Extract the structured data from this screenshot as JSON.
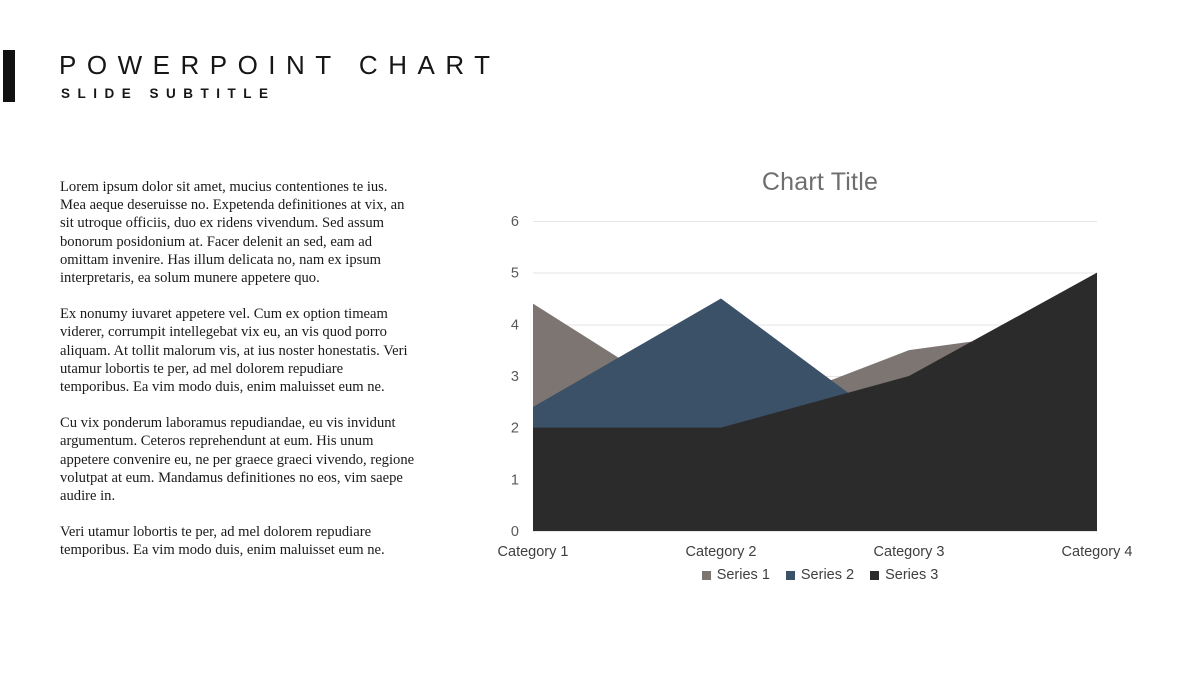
{
  "slide": {
    "title": "POWERPOINT CHART",
    "subtitle": "SLIDE SUBTITLE",
    "accent_color": "#111111"
  },
  "body": {
    "paragraphs": [
      "Lorem ipsum dolor sit amet, mucius contentiones te ius. Mea aeque deseruisse no. Expetenda definitiones at vix, an sit utroque officiis, duo ex ridens vivendum. Sed assum bonorum posidonium at. Facer delenit an sed, eam ad omittam invenire. Has illum delicata no, nam ex ipsum interpretaris, ea solum munere appetere quo.",
      "Ex nonumy iuvaret appetere vel. Cum ex option timeam viderer, corrumpit intellegebat vix eu, an vis quod porro aliquam. At tollit malorum vis, at ius noster honestatis. Veri utamur lobortis te per, ad mel dolorem repudiare temporibus. Ea vim modo duis, enim maluisset eum ne.",
      "Cu vix ponderum laboramus repudiandae, eu vis invidunt argumentum. Ceteros reprehendunt at eum. His unum appetere convenire eu, ne per graece graeci vivendo, regione volutpat at eum. Mandamus definitiones no eos, vim saepe audire in.",
      "Veri utamur lobortis te per, ad mel dolorem repudiare temporibus. Ea vim modo duis, enim maluisset eum ne."
    ]
  },
  "chart_data": {
    "type": "area",
    "title": "Chart Title",
    "xlabel": "",
    "ylabel": "",
    "categories": [
      "Category 1",
      "Category 2",
      "Category 3",
      "Category 4"
    ],
    "series": [
      {
        "name": "Series 1",
        "color": "#7d7571",
        "values": [
          4.4,
          2.1,
          3.5,
          4.0
        ]
      },
      {
        "name": "Series 2",
        "color": "#3a5168",
        "values": [
          2.4,
          4.5,
          1.8,
          0.0
        ]
      },
      {
        "name": "Series 3",
        "color": "#2b2b2b",
        "values": [
          2.0,
          2.0,
          3.0,
          5.0
        ]
      }
    ],
    "ylim": [
      0,
      6
    ],
    "yticks": [
      0,
      1,
      2,
      3,
      4,
      5,
      6
    ],
    "ytick_labels": [
      "0",
      "1",
      "2",
      "3",
      "4",
      "5",
      "6"
    ],
    "grid": true,
    "legend_position": "bottom",
    "stacked": false,
    "title_color": "#6e6e6e"
  }
}
